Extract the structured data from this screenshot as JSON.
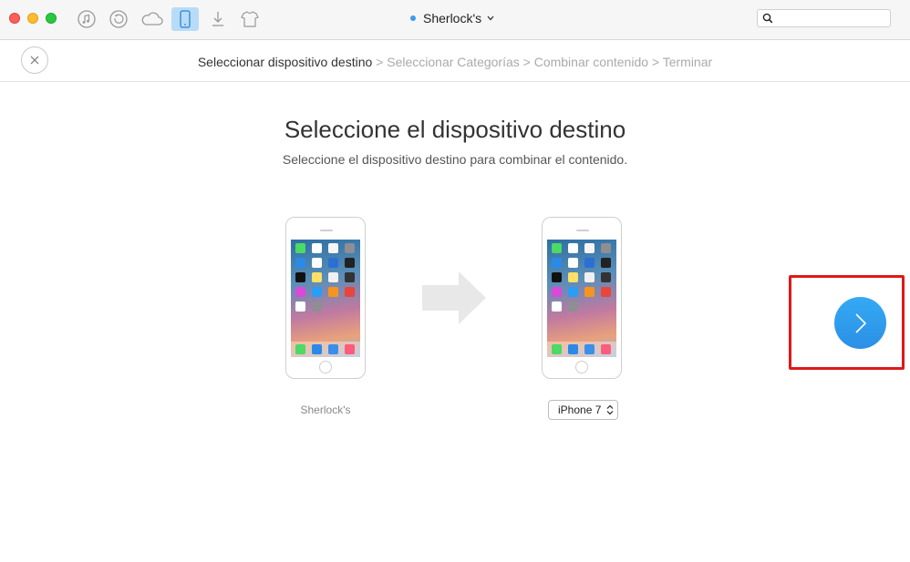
{
  "titlebar": {
    "device_name": "Sherlock's",
    "search": {
      "value": "",
      "placeholder": ""
    },
    "tools": [
      "music-icon",
      "restore-icon",
      "cloud-icon",
      "device-icon",
      "download-icon",
      "shirt-icon"
    ],
    "active_tool": "device-icon"
  },
  "breadcrumb": {
    "current": "Seleccionar dispositivo destino",
    "rest": "> Seleccionar Categorías > Combinar contenido > Terminar"
  },
  "main": {
    "title": "Seleccione el dispositivo destino",
    "subtitle": "Seleccione el dispositivo destino para combinar el contenido.",
    "source_device": "Sherlock's",
    "target_select_value": "iPhone 7"
  },
  "colors": {
    "accent": "#3a9bf0",
    "next_button": "#2b8fe6",
    "highlight_box": "#e01818"
  }
}
